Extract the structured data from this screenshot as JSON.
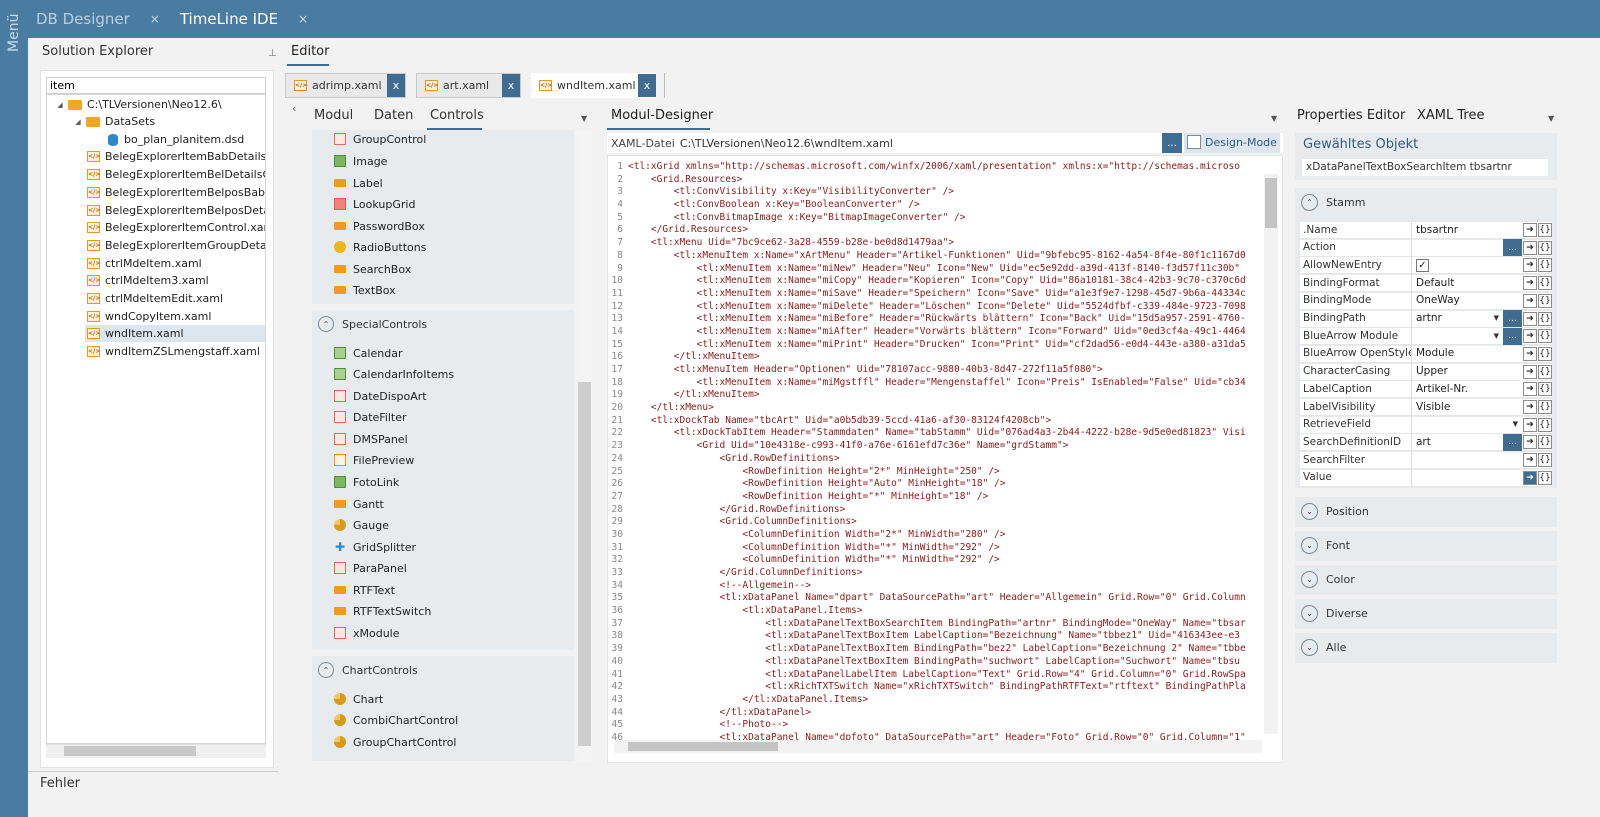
{
  "rail": {
    "label": "Menü"
  },
  "app_tabs": [
    {
      "label": "DB Designer",
      "close": "×"
    },
    {
      "label": "TimeLine IDE",
      "close": "×"
    }
  ],
  "solution_explorer": {
    "title": "Solution Explorer",
    "pin": "⊥",
    "search_value": "item",
    "tree": [
      {
        "label": "C:\\TLVersionen\\Neo12.6\\",
        "icon": "folder-icon",
        "level": 0,
        "caret": "◢"
      },
      {
        "label": "DataSets",
        "icon": "folder-icon",
        "level": 1,
        "caret": "◢"
      },
      {
        "label": "bo_plan_planitem.dsd",
        "icon": "database-icon",
        "level": 2
      },
      {
        "label": "BelegExplorerItemBabDetailsCo",
        "icon": "xaml-file-icon",
        "level": 1
      },
      {
        "label": "BelegExplorerItemBelDetailsCor",
        "icon": "xaml-file-icon",
        "level": 1
      },
      {
        "label": "BelegExplorerItemBelposBabDe",
        "icon": "xaml-file-icon",
        "level": 1
      },
      {
        "label": "BelegExplorerItemBelposDetails",
        "icon": "xaml-file-icon",
        "level": 1
      },
      {
        "label": "BelegExplorerItemControl.xaml",
        "icon": "xaml-file-icon",
        "level": 1
      },
      {
        "label": "BelegExplorerItemGroupDetails",
        "icon": "xaml-file-icon",
        "level": 1
      },
      {
        "label": "ctrlMdeItem.xaml",
        "icon": "xaml-file-icon",
        "level": 1
      },
      {
        "label": "ctrlMdeItem3.xaml",
        "icon": "xaml-file-icon",
        "level": 1
      },
      {
        "label": "ctrlMdeItemEdit.xaml",
        "icon": "xaml-file-icon",
        "level": 1
      },
      {
        "label": "wndCopyItem.xaml",
        "icon": "xaml-file-icon",
        "level": 1
      },
      {
        "label": "wndItem.xaml",
        "icon": "xaml-file-icon",
        "level": 1,
        "selected": true
      },
      {
        "label": "wndItemZSLmengstaff.xaml",
        "icon": "xaml-file-icon",
        "level": 1
      }
    ]
  },
  "bottom": {
    "errors_label": "Fehler"
  },
  "editor": {
    "title": "Editor",
    "collapse": "‹",
    "file_tabs": [
      {
        "label": "adrimp.xaml",
        "close": "x",
        "active": false
      },
      {
        "label": "art.xaml",
        "close": "x",
        "active": false
      },
      {
        "label": "wndItem.xaml",
        "close": "x",
        "active": true
      }
    ]
  },
  "toolbox": {
    "tabs": [
      {
        "label": "Modul"
      },
      {
        "label": "Daten"
      },
      {
        "label": "Controls",
        "active": true
      }
    ],
    "dropdown": "▼",
    "standard_items": [
      {
        "label": "GroupControl",
        "icon": "red-box-icon"
      },
      {
        "label": "Image",
        "icon": "image-icon"
      },
      {
        "label": "Label",
        "icon": "orange-field-icon"
      },
      {
        "label": "LookupGrid",
        "icon": "grid-icon"
      },
      {
        "label": "PasswordBox",
        "icon": "orange-field-icon"
      },
      {
        "label": "RadioButtons",
        "icon": "radio-icon"
      },
      {
        "label": "SearchBox",
        "icon": "orange-field-icon"
      },
      {
        "label": "TextBox",
        "icon": "orange-field-icon"
      }
    ],
    "special": {
      "title": "SpecialControls",
      "items": [
        {
          "label": "Calendar",
          "icon": "calendar-icon"
        },
        {
          "label": "CalendarInfoItems",
          "icon": "calendar-icon"
        },
        {
          "label": "DateDispoArt",
          "icon": "red-box-icon"
        },
        {
          "label": "DateFilter",
          "icon": "red-box-icon"
        },
        {
          "label": "DMSPanel",
          "icon": "red-box-icon"
        },
        {
          "label": "FilePreview",
          "icon": "file-icon"
        },
        {
          "label": "FotoLink",
          "icon": "image-icon"
        },
        {
          "label": "Gantt",
          "icon": "orange-field-icon"
        },
        {
          "label": "Gauge",
          "icon": "pie-icon"
        },
        {
          "label": "GridSplitter",
          "icon": "splitter-icon"
        },
        {
          "label": "ParaPanel",
          "icon": "red-box-icon"
        },
        {
          "label": "RTFText",
          "icon": "orange-field-icon"
        },
        {
          "label": "RTFTextSwitch",
          "icon": "orange-field-icon"
        },
        {
          "label": "xModule",
          "icon": "red-box-icon"
        }
      ]
    },
    "chart": {
      "title": "ChartControls",
      "items": [
        {
          "label": "Chart",
          "icon": "pie-icon"
        },
        {
          "label": "CombiChartControl",
          "icon": "pie-icon"
        },
        {
          "label": "GroupChartControl",
          "icon": "pie-icon"
        }
      ]
    }
  },
  "module_designer": {
    "title": "Modul-Designer",
    "dropdown": "▼",
    "xaml_label": "XAML-Datei",
    "xaml_path": "C:\\TLVersionen\\Neo12.6\\wndItem.xaml",
    "browse": "...",
    "design_mode": "Design-Mode",
    "code_lines": [
      "<tl:xGrid xmlns=\"http://schemas.microsoft.com/winfx/2006/xaml/presentation\" xmlns:x=\"http://schemas.microso",
      "    <Grid.Resources>",
      "        <tl:ConvVisibility x:Key=\"VisibilityConverter\" />",
      "        <tl:ConvBoolean x:Key=\"BooleanConverter\" />",
      "        <tl:ConvBitmapImage x:Key=\"BitmapImageConverter\" />",
      "    </Grid.Resources>",
      "    <tl:xMenu Uid=\"7bc9ce62-3a28-4559-b28e-be0d8d1479aa\">",
      "        <tl:xMenuItem x:Name=\"xArtMenu\" Header=\"Artikel-Funktionen\" Uid=\"9bfebc95-8162-4a54-8f4e-80f1c1167d0",
      "            <tl:xMenuItem x:Name=\"miNew\" Header=\"Neu\" Icon=\"New\" Uid=\"ec5e92dd-a39d-413f-8140-f3d57f11c30b\"",
      "            <tl:xMenuItem x:Name=\"miCopy\" Header=\"Kopieren\" Icon=\"Copy\" Uid=\"86a10181-38c4-42b3-9c70-c370c6d",
      "            <tl:xMenuItem x:Name=\"miSave\" Header=\"Speichern\" Icon=\"Save\" Uid=\"a1e3f9e7-1298-45d7-9b6a-44334c",
      "            <tl:xMenuItem x:Name=\"miDelete\" Header=\"Löschen\" Icon=\"Delete\" Uid=\"5524dfbf-c339-484e-9723-7098",
      "            <tl:xMenuItem x:Name=\"miBefore\" Header=\"Rückwärts blättern\" Icon=\"Back\" Uid=\"15d5a957-2591-4760-",
      "            <tl:xMenuItem x:Name=\"miAfter\" Header=\"Vorwärts blättern\" Icon=\"Forward\" Uid=\"0ed3cf4a-49c1-4464",
      "            <tl:xMenuItem x:Name=\"miPrint\" Header=\"Drucken\" Icon=\"Print\" Uid=\"cf2dad56-e0d4-443e-a380-a31da5",
      "        </tl:xMenuItem>",
      "        <tl:xMenuItem Header=\"Optionen\" Uid=\"78107acc-9880-40b3-8d47-272f11a5f080\">",
      "            <tl:xMenuItem x:Name=\"miMgstffl\" Header=\"Mengenstaffel\" Icon=\"Preis\" IsEnabled=\"False\" Uid=\"cb34",
      "        </tl:xMenuItem>",
      "    </tl:xMenu>",
      "    <tl:xDockTab Name=\"tbcArt\" Uid=\"a0b5db39-5ccd-41a6-af30-83124f4208cb\">",
      "        <tl:xDockTabItem Header=\"Stammdaten\" Name=\"tabStamm\" Uid=\"076ad4a3-2b44-4222-b28e-9d5e0ed81823\" Visi",
      "            <Grid Uid=\"10e4318e-c993-41f0-a76e-6161efd7c36e\" Name=\"grdStamm\">",
      "                <Grid.RowDefinitions>",
      "                    <RowDefinition Height=\"2*\" MinHeight=\"250\" />",
      "                    <RowDefinition Height=\"Auto\" MinHeight=\"18\" />",
      "                    <RowDefinition Height=\"*\" MinHeight=\"18\" />",
      "                </Grid.RowDefinitions>",
      "                <Grid.ColumnDefinitions>",
      "                    <ColumnDefinition Width=\"2*\" MinWidth=\"280\" />",
      "                    <ColumnDefinition Width=\"*\" MinWidth=\"292\" />",
      "                    <ColumnDefinition Width=\"*\" MinWidth=\"292\" />",
      "                </Grid.ColumnDefinitions>",
      "                <!--Allgemein-->",
      "                <tl:xDataPanel Name=\"dpart\" DataSourcePath=\"art\" Header=\"Allgemein\" Grid.Row=\"0\" Grid.Column",
      "                    <tl:xDataPanel.Items>",
      "                        <tl:xDataPanelTextBoxSearchItem BindingPath=\"artnr\" BindingMode=\"OneWay\" Name=\"tbsar",
      "                        <tl:xDataPanelTextBoxItem LabelCaption=\"Bezeichnung\" Name=\"tbbez1\" Uid=\"416343ee-e3",
      "                        <tl:xDataPanelTextBoxItem BindingPath=\"bez2\" LabelCaption=\"Bezeichnung 2\" Name=\"tbbe",
      "                        <tl:xDataPanelTextBoxItem BindingPath=\"suchwort\" LabelCaption=\"Suchwort\" Name=\"tbsu",
      "                        <tl:xDataPanelLabelItem LabelCaption=\"Text\" Grid.Row=\"4\" Grid.Column=\"0\" Grid.RowSpa",
      "                        <tl:xRichTXTSwitch Name=\"xRichTXTSwitch\" BindingPathRTFText=\"rtftext\" BindingPathPla",
      "                    </tl:xDataPanel.Items>",
      "                </tl:xDataPanel>",
      "                <!--Photo-->",
      "                <tl:xDataPanel Name=\"dpfoto\" DataSourcePath=\"art\" Header=\"Foto\" Grid.Row=\"0\" Grid.Column=\"1\""
    ]
  },
  "properties": {
    "tabs": [
      {
        "label": "Properties Editor"
      },
      {
        "label": "XAML Tree"
      }
    ],
    "dropdown": "▼",
    "selected_title": "Gewähltes Objekt",
    "selected_value": "xDataPanelTextBoxSearchItem  tbsartnr",
    "stamm_title": "Stamm",
    "rows": [
      {
        "name": ".Name",
        "value": "tbsartnr"
      },
      {
        "name": "Action",
        "value": "",
        "dots": true
      },
      {
        "name": "AllowNewEntry",
        "value": "",
        "check": "✓"
      },
      {
        "name": "BindingFormat",
        "value": "Default"
      },
      {
        "name": "BindingMode",
        "value": "OneWay"
      },
      {
        "name": "BindingPath",
        "value": "artnr",
        "dd": "▼",
        "dots": true
      },
      {
        "name": "BlueArrow Module",
        "value": "",
        "dd": "▼",
        "dots": true
      },
      {
        "name": "BlueArrow OpenStyle",
        "value": "Module"
      },
      {
        "name": "CharacterCasing",
        "value": "Upper"
      },
      {
        "name": "LabelCaption",
        "value": "Artikel-Nr."
      },
      {
        "name": "LabelVisibility",
        "value": "Visible"
      },
      {
        "name": "RetrieveField",
        "value": "",
        "dd": "▼"
      },
      {
        "name": "SearchDefinitionID",
        "value": "art",
        "dots": true
      },
      {
        "name": "SearchFilter",
        "value": ""
      },
      {
        "name": "Value",
        "value": "",
        "active": true
      }
    ],
    "btn_arrow": "➔",
    "btn_brace": "{}",
    "sections": [
      {
        "label": "Position"
      },
      {
        "label": "Font"
      },
      {
        "label": "Color"
      },
      {
        "label": "Diverse"
      },
      {
        "label": "Alle"
      }
    ]
  }
}
